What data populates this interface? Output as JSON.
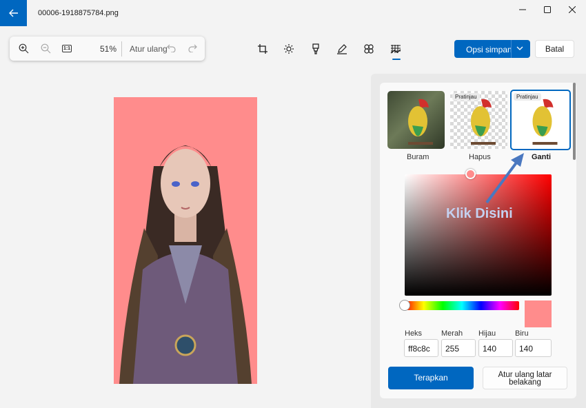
{
  "titlebar": {
    "file_name": "00006-1918875784.png"
  },
  "zoombar": {
    "zoom_value": "51%",
    "actual_size_label": "1:1",
    "reset_label": "Atur ulang"
  },
  "tools": [
    "crop-icon",
    "brightness-icon",
    "markup-icon",
    "draw-icon",
    "effects-icon",
    "background-icon"
  ],
  "actions": {
    "save_label": "Opsi simpan",
    "cancel_label": "Batal"
  },
  "background_panel": {
    "preview_badge": "Pratinjau",
    "options": [
      {
        "label": "Buram",
        "selected": false
      },
      {
        "label": "Hapus",
        "selected": false
      },
      {
        "label": "Ganti",
        "selected": true
      }
    ],
    "color": {
      "hex_label": "Heks",
      "hex": "ff8c8c",
      "red_label": "Merah",
      "red": "255",
      "green_label": "Hijau",
      "green": "140",
      "blue_label": "Biru",
      "blue": "140",
      "swatch_color": "#ff8c8c"
    },
    "apply_label": "Terapkan",
    "reset_background_label": "Atur ulang latar belakang"
  },
  "annotation": {
    "text": "Klik Disini",
    "color": "#3f6db5"
  },
  "colors": {
    "accent": "#0067c0",
    "background_replace": "#ff8c8c"
  }
}
